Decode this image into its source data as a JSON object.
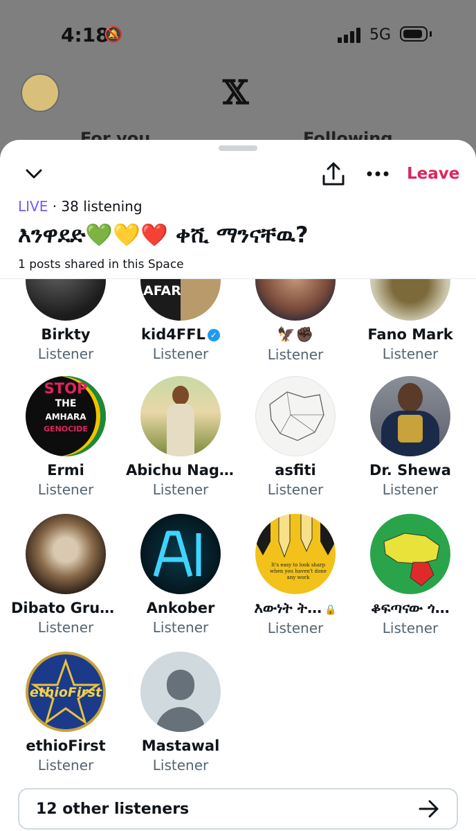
{
  "status_bar": {
    "time": "4:18",
    "network": "5G"
  },
  "background": {
    "tab_left": "For you",
    "tab_right": "Following"
  },
  "space": {
    "live_label": "LIVE",
    "listening": "· 38 listening",
    "title": "እንዋደድ💚💛❤️ ቀሺ ማንናቸዉ?",
    "posts_shared": "1 posts shared in this Space",
    "leave_label": "Leave"
  },
  "participants": [
    {
      "name": "Birkty",
      "role": "Listener",
      "avatar": "dark-portrait"
    },
    {
      "name": "kid4FFL",
      "role": "Listener",
      "verified": true,
      "avatar": "afar-portrait"
    },
    {
      "name": "🦅✊🏿",
      "role": "Listener",
      "avatar": "man-portrait"
    },
    {
      "name": "Fano Mark",
      "role": "Listener",
      "avatar": "emperor-seal"
    },
    {
      "name": "Ermi",
      "role": "Listener",
      "avatar": "stop-genocide"
    },
    {
      "name": "Abichu Nagaa",
      "role": "Listener",
      "avatar": "painted-woman"
    },
    {
      "name": "asfiti",
      "role": "Listener",
      "avatar": "map-sketch"
    },
    {
      "name": "Dr. Shewa",
      "role": "Listener",
      "avatar": "emperor-portrait"
    },
    {
      "name": "Dibato Gruy…",
      "role": "Listener",
      "avatar": "elder-man"
    },
    {
      "name": "Ankober",
      "role": "Listener",
      "avatar": "ai-logo"
    },
    {
      "name": "እውነት ት…",
      "role": "Listener",
      "locked": true,
      "avatar": "pencils"
    },
    {
      "name": "ቆፍጣናው ጎ…",
      "role": "Listener",
      "avatar": "region-map"
    },
    {
      "name": "ethioFirst",
      "role": "Listener",
      "avatar": "ethiofirst-badge"
    },
    {
      "name": "Mastawal",
      "role": "Listener",
      "avatar": "default-avatar"
    }
  ],
  "avatar_text": {
    "stop": "STOP",
    "the": "THE",
    "amhara": "AMHARA",
    "genocide": "GENOCIDE",
    "afar": "AFAR",
    "pencil_caption": "It's easy to look sharp when you haven't done any work",
    "ethiofirst": "ethioFirst"
  },
  "other_listeners": {
    "label": "12 other listeners"
  },
  "icons": [
    "chevron-down-icon",
    "share-icon",
    "more-icon",
    "arrow-right-icon",
    "verified-icon",
    "lock-icon",
    "bell-off-icon"
  ],
  "colors": {
    "live": "#7856ff",
    "leave": "#e0245e",
    "verified": "#1d9bf0",
    "secondary_text": "#536471"
  }
}
